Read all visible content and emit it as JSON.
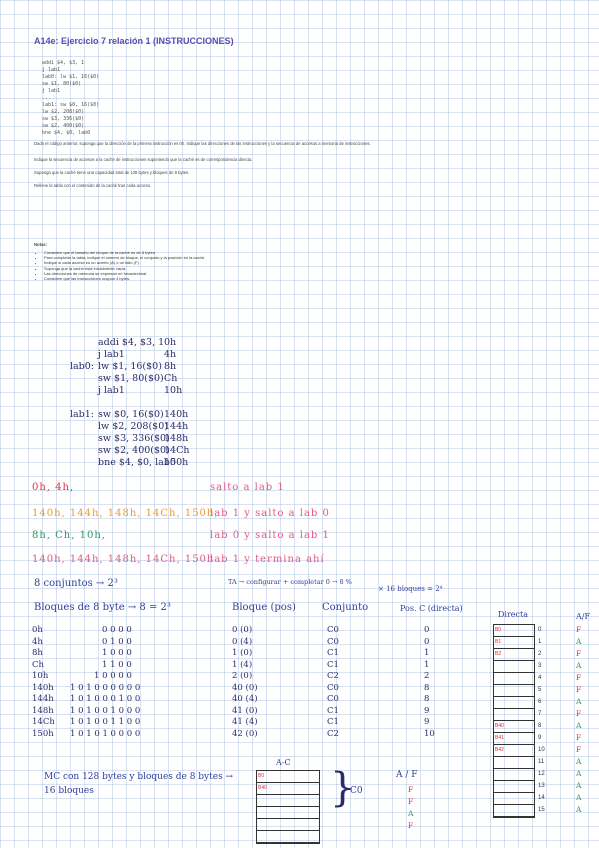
{
  "title": "A14e: Ejercicio 7 relación 1 (INSTRUCCIONES)",
  "code_top": "addi $4, $3, 1\nj lab1\nlab0: lw $1, 16($0)\nsw $1, 80($0)\nj lab1\n...\nlab1: sw $0, 16($0)\nlw $2, 208($0)\nsw $3, 336($0)\nsw $2, 400($0)\nbne $4, $0, lab0",
  "paragraphs": [
    "Dado el código anterior, suponga que la dirección de la primera instrucción es 0h. Indique las direcciones de las instrucciones y la secuencia de accesos a memoria de instrucciones.",
    "Indique la secuencia de accesos a la caché de instrucciones suponiendo que la caché es de correspondencia directa.",
    "Suponga que la caché tiene una capacidad total de 128 bytes y bloques de 8 bytes.",
    "Rellene la tabla con el contenido de la caché tras cada acceso."
  ],
  "notes_head": "Notas:",
  "bullets": [
    "Considere que el tamaño del bloque de la caché es de 8 bytes.",
    "Para completar la tabla, indique el número de bloque, el conjunto y la posición en la caché.",
    "Indique si cada acceso es un acierto (A) o un fallo (F).",
    "Suponga que la caché está inicialmente vacía.",
    "Las direcciones de memoria se expresan en hexadecimal.",
    "Considere que las instrucciones ocupan 4 bytes."
  ],
  "asm": [
    {
      "label": "",
      "ins": "addi $4, $3, 1",
      "addr": "0h"
    },
    {
      "label": "",
      "ins": "j lab1",
      "addr": "4h"
    },
    {
      "label": "lab0:",
      "ins": "lw $1, 16($0)",
      "addr": "8h"
    },
    {
      "label": "",
      "ins": "sw $1, 80($0)",
      "addr": "Ch"
    },
    {
      "label": "",
      "ins": "j lab1",
      "addr": "10h"
    },
    {
      "label": "",
      "ins": "",
      "addr": ""
    },
    {
      "label": "lab1:",
      "ins": "sw $0, 16($0)",
      "addr": "140h"
    },
    {
      "label": "",
      "ins": "lw $2, 208($0)",
      "addr": "144h"
    },
    {
      "label": "",
      "ins": "sw $3, 336($0)",
      "addr": "148h"
    },
    {
      "label": "",
      "ins": "sw $2, 400($0)",
      "addr": "14Ch"
    },
    {
      "label": "",
      "ins": "bne $4, $0, lab0",
      "addr": "150h"
    }
  ],
  "seq": [
    {
      "addrs": "0h, 4h,",
      "note": "salto a lab 1"
    },
    {
      "addrs": "140h, 144h, 148h, 14Ch, 150h,",
      "note": "lab 1 y salto a lab 0"
    },
    {
      "addrs": "8h, Ch, 10h,",
      "note": "lab 0 y salto a lab 1"
    },
    {
      "addrs": "140h, 144h, 148h, 14Ch, 150h",
      "note": "lab 1 y termina ahí"
    }
  ],
  "conj_line": "8 conjuntos → 2³",
  "ta_line": "TA → configurar + completar   0 → 8 % ",
  "bloques_line": "× 16 bloques = 2⁴",
  "headers": {
    "bloques": "Bloques de 8 byte → 8 = 2³",
    "bloque_pos": "Bloque (pos)",
    "conjunto": "Conjunto",
    "posc": "Pos. C (directa)",
    "directa": "Directa",
    "af": "A/F"
  },
  "table": [
    {
      "dir": "0h",
      "bits": "0 0 0 0",
      "bloque": "0 (0)",
      "conj": "C0",
      "pos": "0"
    },
    {
      "dir": "4h",
      "bits": "0 1 0 0",
      "bloque": "0 (4)",
      "conj": "C0",
      "pos": "0"
    },
    {
      "dir": "8h",
      "bits": "1 0 0 0",
      "bloque": "1 (0)",
      "conj": "C1",
      "pos": "1"
    },
    {
      "dir": "Ch",
      "bits": "1 1 0 0",
      "bloque": "1 (4)",
      "conj": "C1",
      "pos": "1"
    },
    {
      "dir": "10h",
      "bits": "1 0 0 0 0",
      "bloque": "2 (0)",
      "conj": "C2",
      "pos": "2"
    },
    {
      "dir": "140h",
      "bits": "1 0 1 0 0 0 0 0 0",
      "bloque": "40 (0)",
      "conj": "C0",
      "pos": "8"
    },
    {
      "dir": "144h",
      "bits": "1 0 1 0 0 0 1 0 0",
      "bloque": "40 (4)",
      "conj": "C0",
      "pos": "8"
    },
    {
      "dir": "148h",
      "bits": "1 0 1 0 0 1 0 0 0",
      "bloque": "41 (0)",
      "conj": "C1",
      "pos": "9"
    },
    {
      "dir": "14Ch",
      "bits": "1 0 1 0 0 1 1 0 0",
      "bloque": "41 (4)",
      "conj": "C1",
      "pos": "9"
    },
    {
      "dir": "150h",
      "bits": "1 0 1 0 1 0 0 0 0",
      "bloque": "42 (0)",
      "conj": "C2",
      "pos": "10"
    }
  ],
  "cache_cells": [
    "B0",
    "B1",
    "B2",
    "",
    "",
    "",
    "",
    "",
    "B40",
    "B41",
    "B42",
    "",
    "",
    "",
    "",
    ""
  ],
  "cache_index": [
    "0",
    "1",
    "2",
    "3",
    "4",
    "5",
    "6",
    "7",
    "8",
    "9",
    "10",
    "11",
    "12",
    "13",
    "14",
    "15"
  ],
  "af_list": [
    "F",
    "A",
    "F",
    "A",
    "F",
    "F",
    "A",
    "F",
    "A",
    "F",
    "F",
    "A",
    "A",
    "A",
    "A",
    "A"
  ],
  "mc_note": "MC con 128 bytes y bloques de 8 bytes → 16 bloques",
  "ac_label": "A-C",
  "ac_cells": [
    "B0",
    "B40"
  ],
  "c0_label": "C0",
  "af2_label": "A / F",
  "af2": [
    "F",
    "F",
    "A",
    "F"
  ]
}
